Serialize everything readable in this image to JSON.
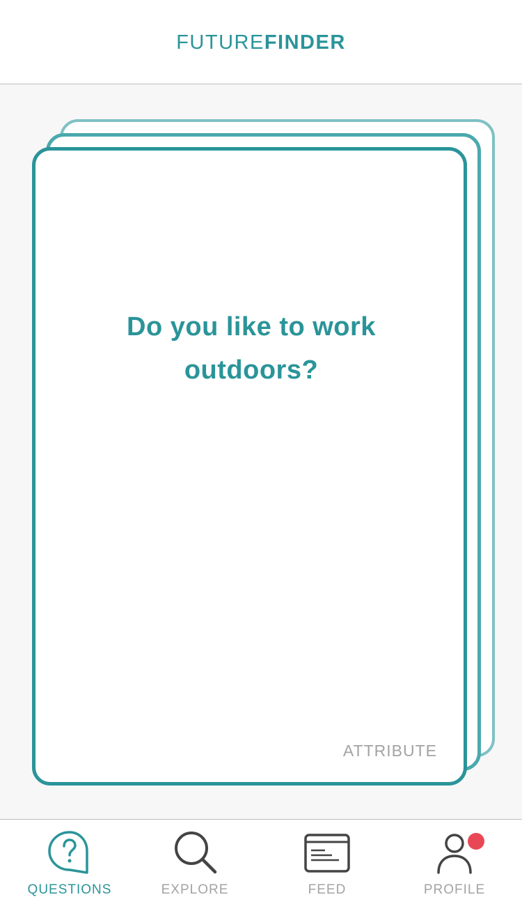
{
  "app": {
    "title_light": "FUTURE",
    "title_bold": "FINDER"
  },
  "card": {
    "question": "Do you like to work outdoors?",
    "attribute_label": "ATTRIBUTE"
  },
  "tabs": [
    {
      "label": "QUESTIONS",
      "icon": "question-bubble-icon",
      "active": true
    },
    {
      "label": "EXPLORE",
      "icon": "search-icon",
      "active": false
    },
    {
      "label": "FEED",
      "icon": "feed-icon",
      "active": false
    },
    {
      "label": "PROFILE",
      "icon": "profile-icon",
      "active": false,
      "notification": true
    }
  ],
  "colors": {
    "accent": "#2a9499",
    "inactive": "#a3a3a3",
    "icon_dark": "#444444",
    "notification": "#e84855"
  }
}
